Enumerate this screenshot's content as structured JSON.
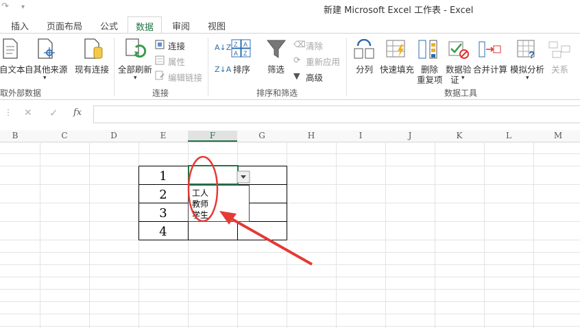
{
  "window": {
    "title": "新建 Microsoft Excel 工作表 - Excel"
  },
  "tabs": [
    "插入",
    "页面布局",
    "公式",
    "数据",
    "审阅",
    "视图"
  ],
  "active_tab": "数据",
  "ribbon": {
    "get_external": {
      "from_text": "自文本",
      "other_sources": "自其他来源",
      "group_label": "取外部数据"
    },
    "existing": "现有连接",
    "connections": {
      "refresh_all": "全部刷新",
      "connections": "连接",
      "properties": "属性",
      "edit_links": "编辑链接",
      "group_label": "连接"
    },
    "sort_filter": {
      "az": "A↓Z",
      "za": "Z↓A",
      "sort": "排序",
      "filter": "筛选",
      "clear": "清除",
      "reapply": "重新应用",
      "advanced": "高级",
      "group_label": "排序和筛选"
    },
    "data_tools": {
      "text_to_columns": "分列",
      "flash_fill": "快速填充",
      "remove_dup_1": "删除",
      "remove_dup_2": "重复项",
      "validation_1": "数据验",
      "validation_2": "证",
      "consolidate": "合并计算",
      "what_if": "模拟分析",
      "relationships": "关系",
      "group_label": "数据工具"
    }
  },
  "formula_bar": {
    "cancel": "✕",
    "enter": "✓",
    "fx": "fx",
    "value": ""
  },
  "columns": [
    "B",
    "C",
    "D",
    "E",
    "F",
    "G",
    "H",
    "I",
    "J",
    "K",
    "L",
    "M"
  ],
  "table": {
    "row_numbers": [
      "1",
      "2",
      "3",
      "4"
    ]
  },
  "dropdown": {
    "options": [
      "工人",
      "教师",
      "学生"
    ]
  },
  "colors": {
    "accent": "#217346",
    "annotation": "#e53935"
  }
}
